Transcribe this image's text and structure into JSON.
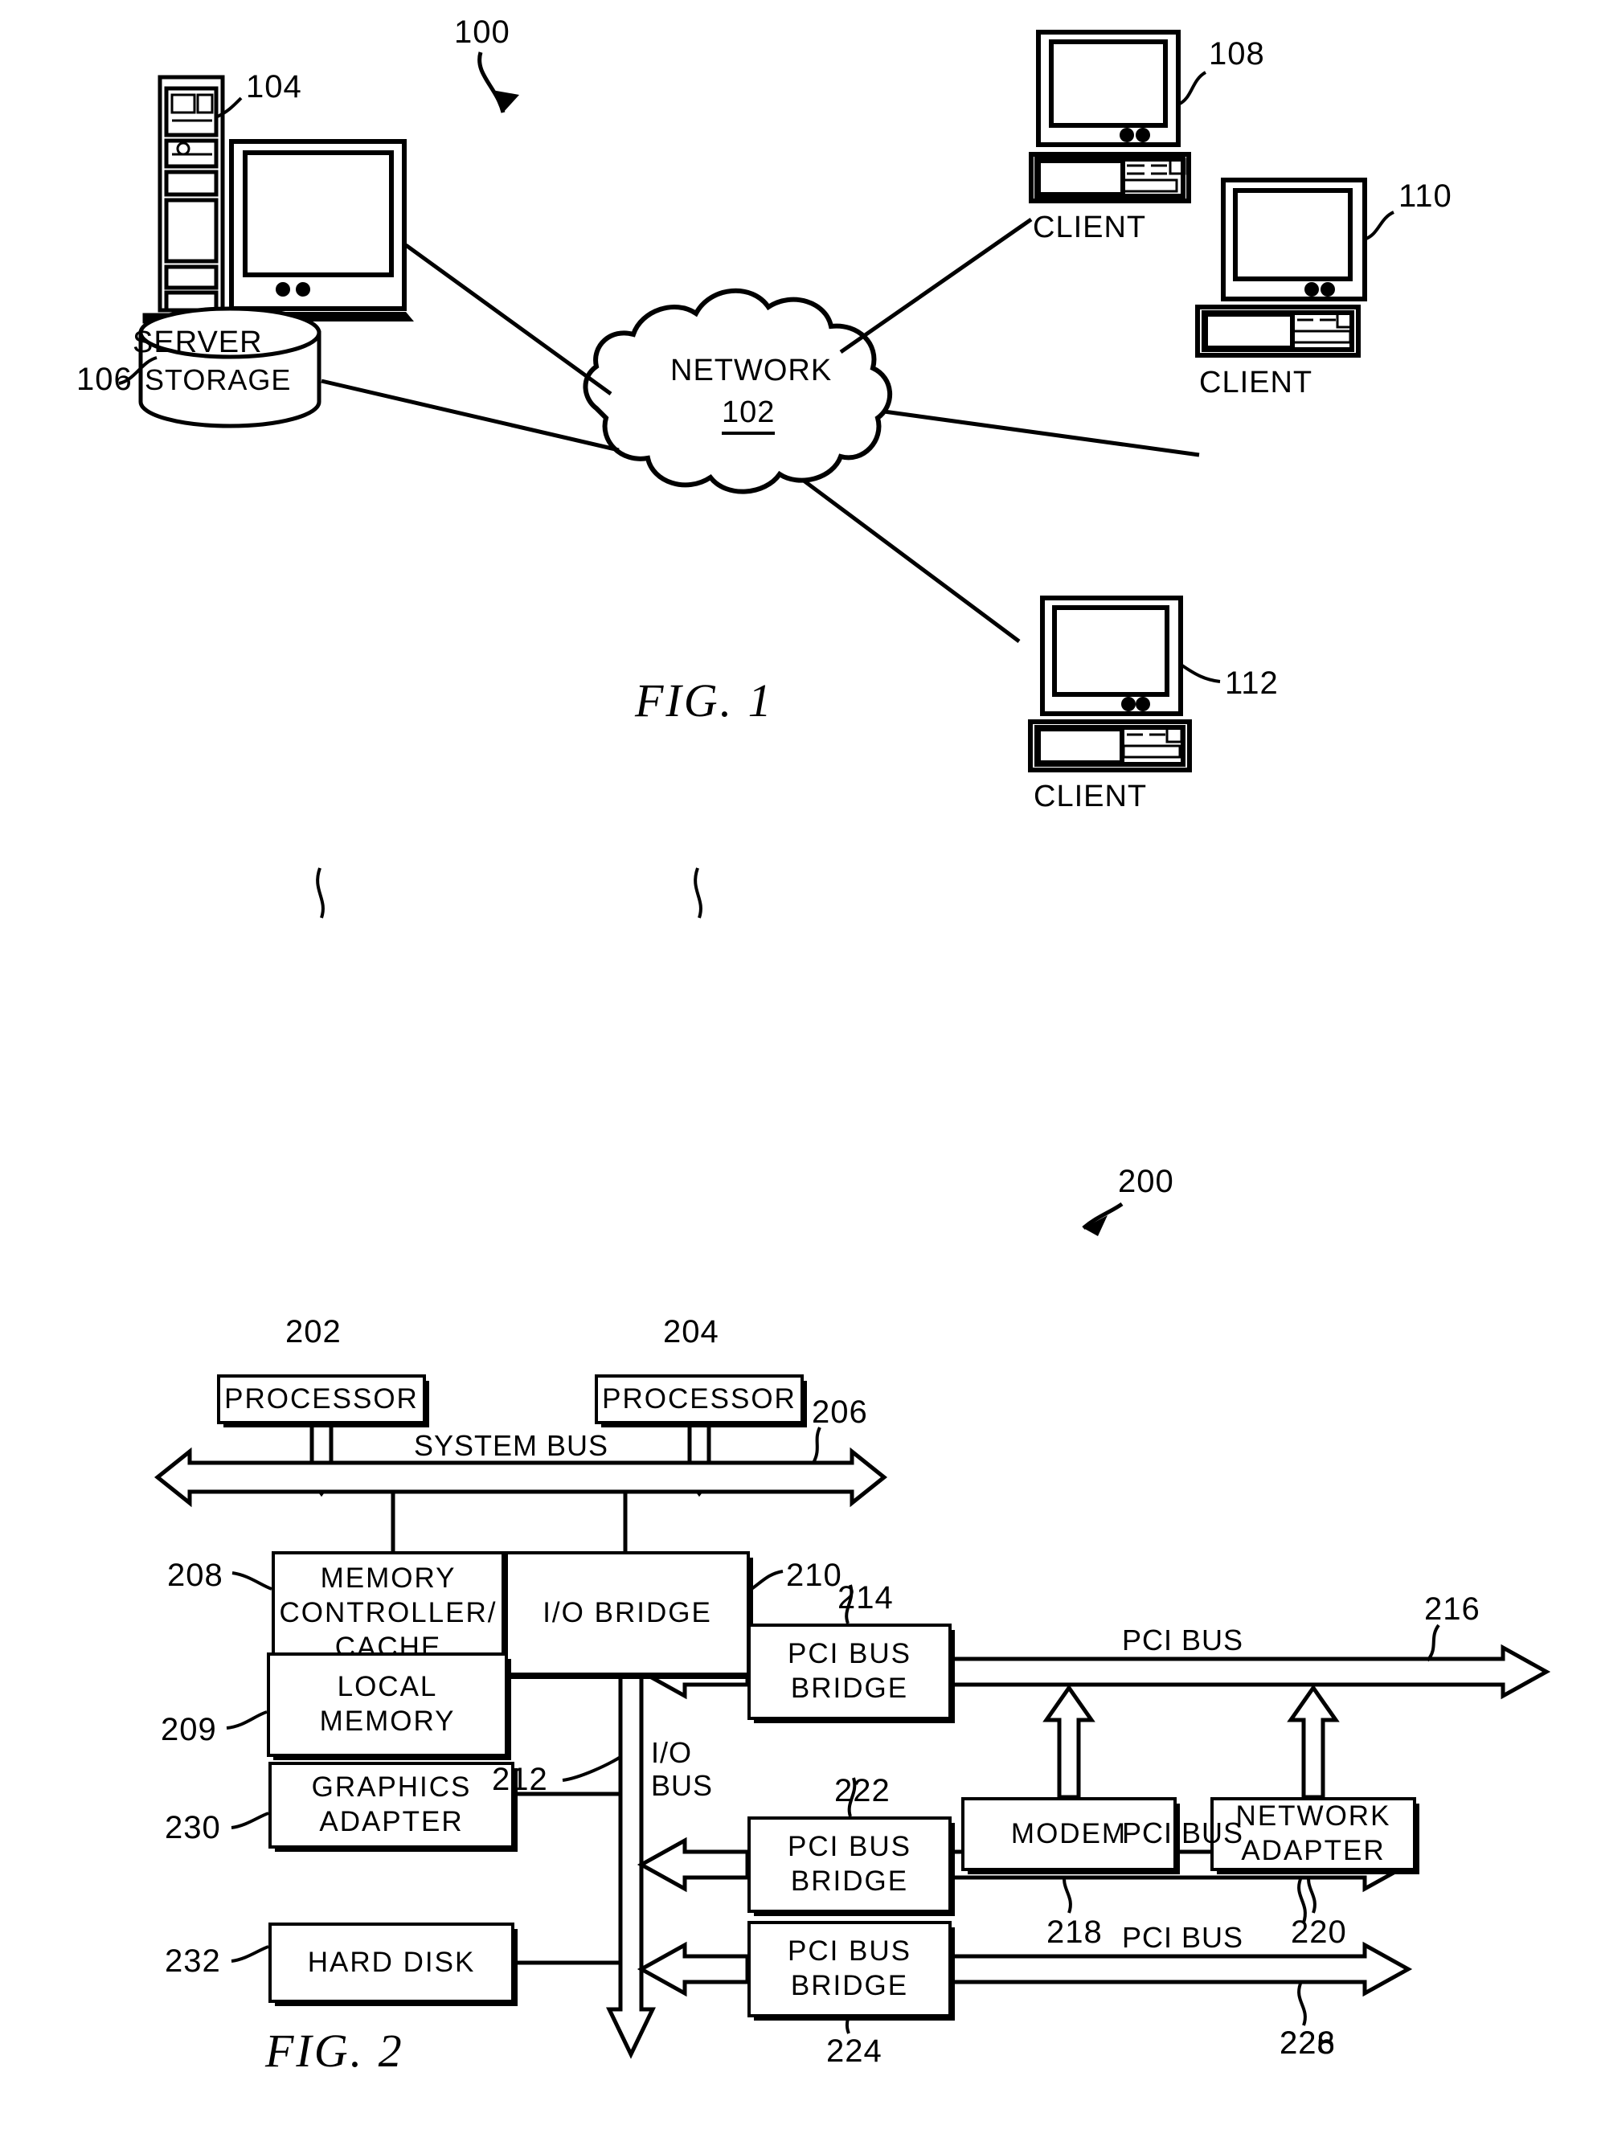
{
  "figure1": {
    "caption": "FIG.  1",
    "ref_number": "100",
    "nodes": {
      "server": {
        "label": "SERVER",
        "ref": "104"
      },
      "storage": {
        "label": "STORAGE",
        "ref": "106"
      },
      "network": {
        "label": "NETWORK",
        "ref": "102"
      },
      "client_top": {
        "label": "CLIENT",
        "ref": "108"
      },
      "client_middle": {
        "label": "CLIENT",
        "ref": "110"
      },
      "client_bottom": {
        "label": "CLIENT",
        "ref": "112"
      }
    }
  },
  "figure2": {
    "caption": "FIG.  2",
    "ref_number": "200",
    "blocks": {
      "processor_left": {
        "label": "PROCESSOR",
        "ref": "202"
      },
      "processor_right": {
        "label": "PROCESSOR",
        "ref": "204"
      },
      "memory_controller": {
        "label": "MEMORY\nCONTROLLER/\nCACHE",
        "ref": "208"
      },
      "io_bridge": {
        "label": "I/O BRIDGE",
        "ref": "210"
      },
      "local_memory": {
        "label": "LOCAL\nMEMORY",
        "ref": "209"
      },
      "pci_bus_bridge_1": {
        "label": "PCI BUS\nBRIDGE",
        "ref": "214"
      },
      "pci_bus_bridge_2": {
        "label": "PCI BUS\nBRIDGE",
        "ref": "222"
      },
      "pci_bus_bridge_3": {
        "label": "PCI BUS\nBRIDGE",
        "ref": "224"
      },
      "modem": {
        "label": "MODEM",
        "ref": "218"
      },
      "network_adapter": {
        "label": "NETWORK\nADAPTER",
        "ref": "220"
      },
      "graphics_adapter": {
        "label": "GRAPHICS\nADAPTER",
        "ref": "230"
      },
      "hard_disk": {
        "label": "HARD DISK",
        "ref": "232"
      }
    },
    "buses": {
      "system_bus": {
        "label": "SYSTEM BUS",
        "ref": "206"
      },
      "io_bus": {
        "label": "I/O\nBUS",
        "ref": "212"
      },
      "pci_bus_1": {
        "label": "PCI BUS",
        "ref": "216"
      },
      "pci_bus_2": {
        "label": "PCI BUS",
        "ref": "226"
      },
      "pci_bus_3": {
        "label": "PCI BUS",
        "ref": "228"
      }
    }
  },
  "colors": {
    "ink": "#000000",
    "paper": "#ffffff"
  }
}
